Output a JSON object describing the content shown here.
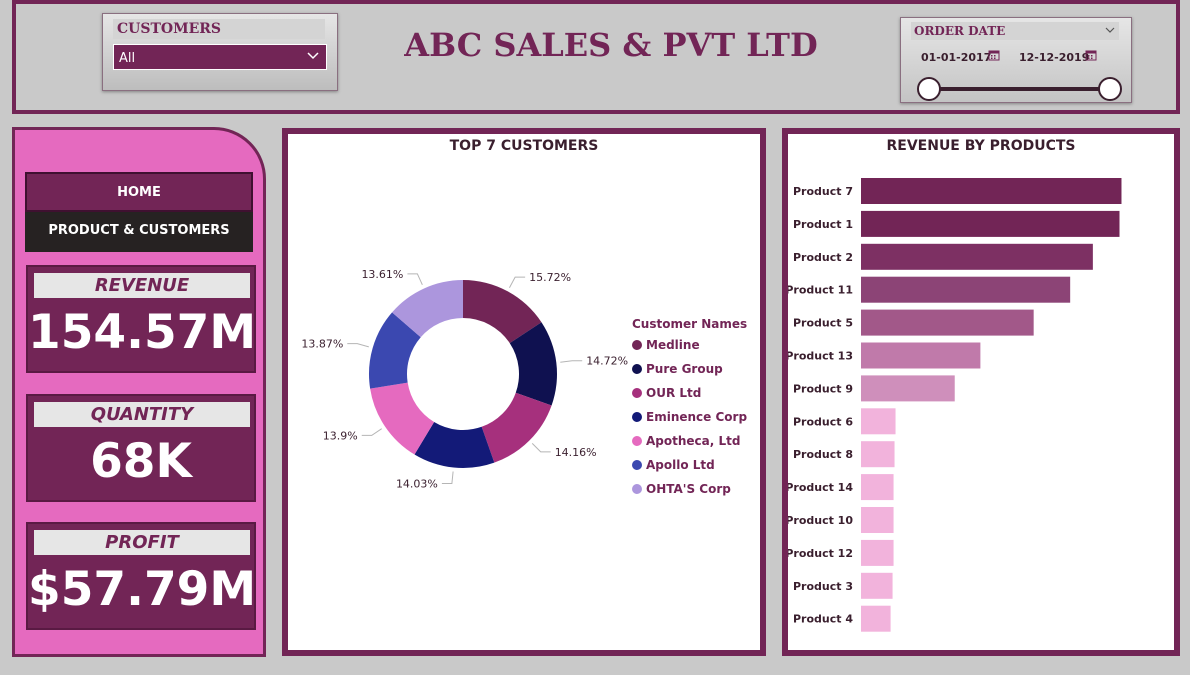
{
  "header": {
    "title": "ABC SALES & PVT LTD",
    "customer_slicer": {
      "label": "CUSTOMERS",
      "value": "All"
    },
    "date_slicer": {
      "label": "ORDER DATE",
      "start": "01-01-2017",
      "end": "12-12-2019"
    }
  },
  "nav": {
    "home": "HOME",
    "products_customers": "PRODUCT & CUSTOMERS"
  },
  "kpis": {
    "revenue": {
      "label": "REVENUE",
      "value": "154.57M"
    },
    "quantity": {
      "label": "QUANTITY",
      "value": "68K"
    },
    "profit": {
      "label": "PROFIT",
      "value": "$57.79M"
    }
  },
  "colors": {
    "brand": "#722556",
    "accent_pink": "#e56abf",
    "background": "#c9c9c9"
  },
  "icons": {
    "dropdown": "chevron-down-icon",
    "calendar": "calendar-icon"
  },
  "chart_data": [
    {
      "type": "pie",
      "title": "TOP 7 CUSTOMERS",
      "legend_title": "Customer Names",
      "legend_position": "right",
      "categories": [
        "Medline",
        "Pure Group",
        "OUR Ltd",
        "Eminence Corp",
        "Apotheca, Ltd",
        "Apollo Ltd",
        "OHTA'S Corp"
      ],
      "values": [
        15.72,
        14.72,
        14.16,
        14.03,
        13.9,
        13.87,
        13.61
      ],
      "labels": [
        "15.72%",
        "14.72%",
        "14.16%",
        "14.03%",
        "13.9%",
        "13.87%",
        "13.61%"
      ],
      "colors": [
        "#722556",
        "#0f1150",
        "#a6307d",
        "#131a78",
        "#e56abf",
        "#3b48b0",
        "#ac96dd"
      ]
    },
    {
      "type": "bar",
      "orientation": "horizontal",
      "title": "REVENUE BY PRODUCTS",
      "categories": [
        "Product 7",
        "Product 1",
        "Product 2",
        "Product 11",
        "Product 5",
        "Product 13",
        "Product 9",
        "Product 6",
        "Product 8",
        "Product 14",
        "Product 10",
        "Product 12",
        "Product 3",
        "Product 4"
      ],
      "values": [
        26.4,
        26.2,
        23.5,
        21.2,
        17.5,
        12.1,
        9.5,
        3.5,
        3.4,
        3.3,
        3.3,
        3.3,
        3.2,
        3.0
      ],
      "xlim": [
        0,
        30
      ],
      "colors": [
        "#722556",
        "#722556",
        "#7d3063",
        "#8c4476",
        "#a25889",
        "#c07aaa",
        "#cf8fbb",
        "#f2b3dc",
        "#f2b3dc",
        "#f2b3dc",
        "#f2b3dc",
        "#f2b3dc",
        "#f2b3dc",
        "#f2b3dc"
      ]
    }
  ]
}
